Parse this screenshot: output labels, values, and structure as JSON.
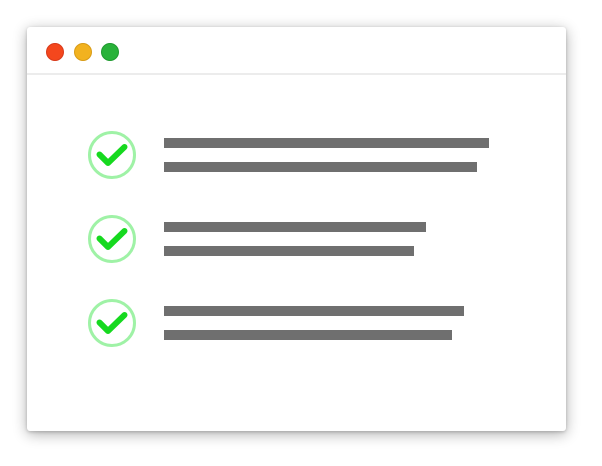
{
  "window": {
    "controls": [
      {
        "name": "close",
        "color": "#f4471d",
        "border": "#d8391a"
      },
      {
        "name": "minimize",
        "color": "#f2b21f",
        "border": "#d89b16"
      },
      {
        "name": "maximize",
        "color": "#29b23a",
        "border": "#1f9a2f"
      }
    ]
  },
  "checklist": {
    "check_ring_color": "#9ff2a6",
    "check_mark_color": "#16d91f",
    "placeholder_bar_color": "#6f6f6f",
    "items": [
      {
        "state": "checked",
        "icon": "check-circle-icon"
      },
      {
        "state": "checked",
        "icon": "check-circle-icon"
      },
      {
        "state": "checked",
        "icon": "check-circle-icon"
      }
    ]
  }
}
